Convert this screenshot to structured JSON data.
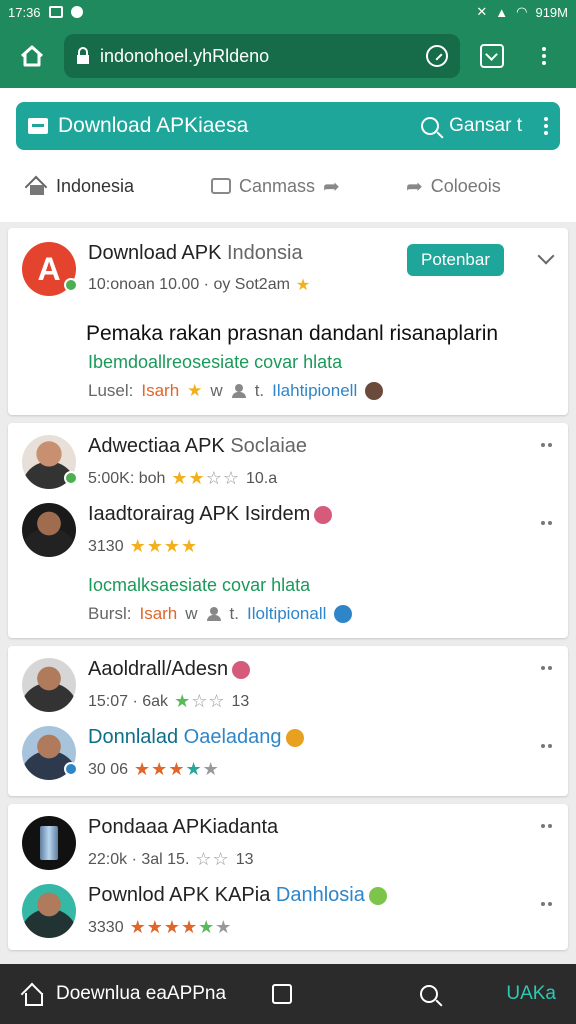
{
  "status_bar": {
    "time": "17:36",
    "battery": "919M"
  },
  "browser": {
    "url": "indonohoel.yhRldeno"
  },
  "appbar": {
    "title": "Download APKiaesa",
    "search_label": "Gansar t"
  },
  "tabs": [
    {
      "label": "Indonesia"
    },
    {
      "label": "Canmass"
    },
    {
      "label": "Coloeois"
    }
  ],
  "featured": {
    "name": "Download APK",
    "name_suffix": "Indonsia",
    "meta": "10:onoan 10.00 · oy Sot2am",
    "pill": "Potenbar",
    "description": "Pemaka rakan prasnan dandanl risanaplarin",
    "link": "Ibemdoallreosesiate covar hlata",
    "footer": {
      "label": "Lusel:",
      "tag": "Isarh",
      "sep": "t.",
      "link": "Ilahtipionell"
    },
    "avatar_letter": "A"
  },
  "groups": [
    {
      "items": [
        {
          "name": "Adwectiaa APK",
          "name_suffix": "Soclaiae",
          "meta": "5:00K: boh",
          "rating": 2
        },
        {
          "name": "Iaadtorairag APK Isirdem",
          "meta": "3130",
          "rating": 4
        }
      ],
      "link": "Iocmalksaesiate covar hlata",
      "footer": {
        "label": "Bursl:",
        "tag": "Isarh",
        "sep": "t.",
        "link": "Iloltipionall"
      }
    },
    {
      "items": [
        {
          "name": "Aaoldrall/Adesn",
          "meta": "15:07 · 6ak",
          "rating": 2,
          "rating_note": "13"
        },
        {
          "name": "Donnlalad",
          "name_suffix": "Oaeladang",
          "meta": "30 06",
          "rating": 3
        }
      ]
    },
    {
      "items": [
        {
          "name": "Pondaaa APKiadanta",
          "meta": "22:0k · 3al 15.",
          "rating": 2,
          "rating_note": "13"
        },
        {
          "name": "Pownlod APK KAPia",
          "name_suffix": "Danhlosia",
          "meta": "3330",
          "rating": 5
        }
      ]
    }
  ],
  "bottom_bar": {
    "label": "Doewnlua eaAPPna",
    "accent": "UAKa"
  },
  "colors": {
    "brand": "#1f8a5e",
    "accent": "#1fa69a",
    "link": "#1a9a5a",
    "star": "#f2b01e"
  }
}
